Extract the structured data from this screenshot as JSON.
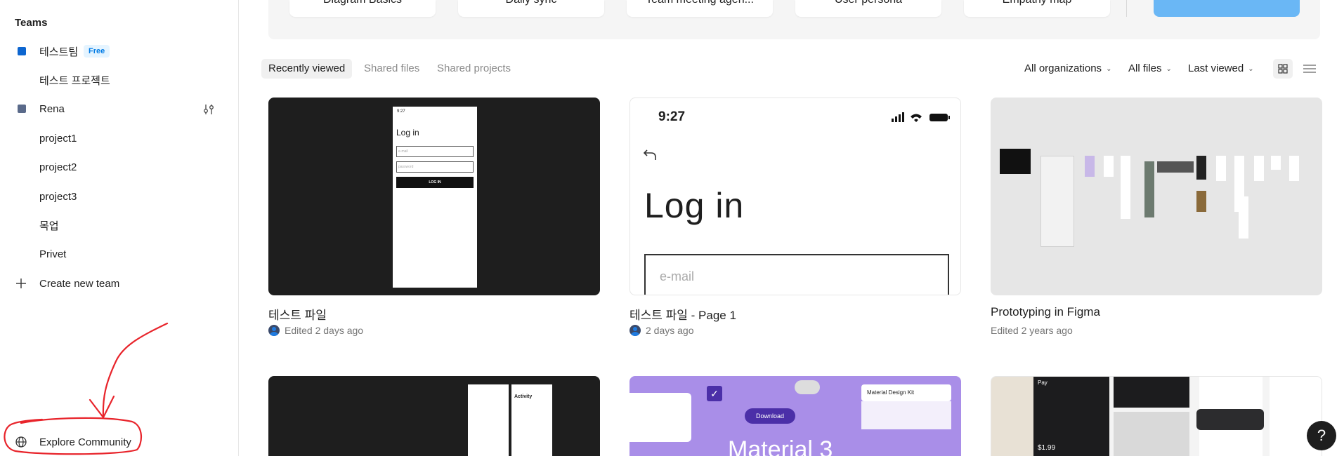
{
  "sidebar": {
    "title": "Teams",
    "items": [
      {
        "label": "테스트팀",
        "badge": "Free",
        "color": "#0d66d0"
      },
      {
        "label": "테스트 프로젝트"
      },
      {
        "label": "Rena",
        "color": "#5a6a8a"
      },
      {
        "label": "project1"
      },
      {
        "label": "project2"
      },
      {
        "label": "project3"
      },
      {
        "label": "목업"
      },
      {
        "label": "Privet"
      },
      {
        "label": "Create new team",
        "icon": "plus-icon"
      }
    ],
    "explore": {
      "label": "Explore Community",
      "icon": "globe-icon"
    }
  },
  "templates": [
    {
      "label": "Diagram Basics"
    },
    {
      "label": "Daily sync"
    },
    {
      "label": "Team meeting agen..."
    },
    {
      "label": "User persona"
    },
    {
      "label": "Empathy map"
    }
  ],
  "tabs": [
    {
      "label": "Recently viewed"
    },
    {
      "label": "Shared files"
    },
    {
      "label": "Shared projects"
    }
  ],
  "filters": {
    "organizations": "All organizations",
    "files": "All files",
    "sort": "Last viewed"
  },
  "files": [
    {
      "name": "테스트 파일",
      "meta": "Edited 2 days ago",
      "avatar": true,
      "phone": {
        "time": "9:27",
        "title": "Log in",
        "email": "e-mail",
        "password": "password",
        "button": "LOG IN"
      }
    },
    {
      "name": "테스트 파일 - Page 1",
      "meta": "2 days ago",
      "avatar": true,
      "phone": {
        "time": "9:27",
        "title": "Log in",
        "email": "e-mail"
      }
    },
    {
      "name": "Prototyping in Figma",
      "meta": "Edited 2 years ago",
      "avatar": false
    }
  ],
  "second_row": {
    "activity": "Activity",
    "material_kit": "Material Design Kit",
    "download": "Download",
    "material_title": "Material 3",
    "pay": "Pay",
    "price": "$1.99"
  },
  "help": "?",
  "colors": {
    "accent": "#0d66d0",
    "annotation": "#e8242b",
    "badge_bg": "#e5f4ff",
    "badge_text": "#007be5"
  }
}
